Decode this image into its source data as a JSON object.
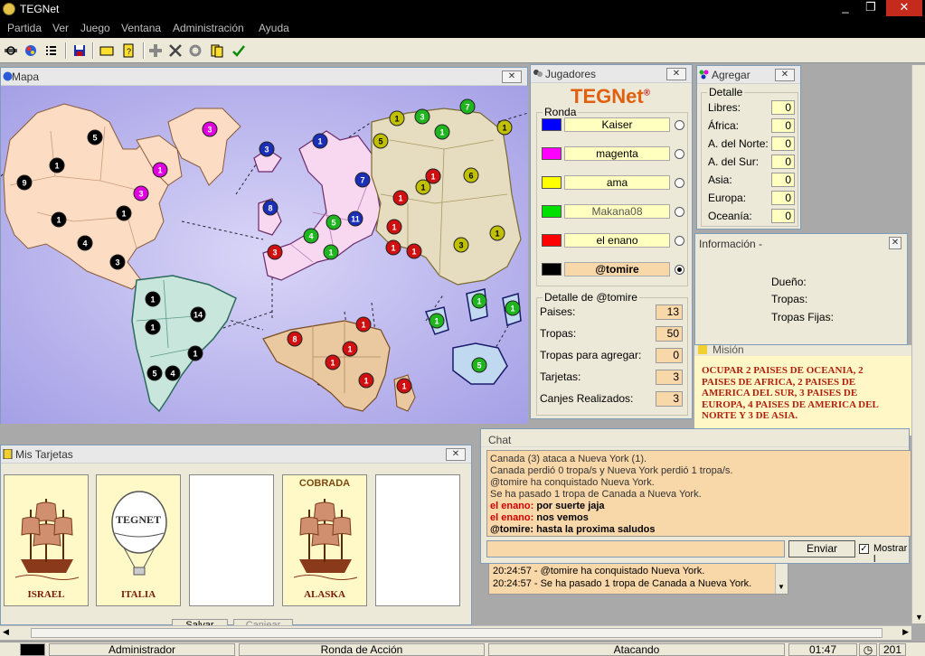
{
  "window": {
    "title": "TEGNet",
    "min": "_",
    "max": "❐",
    "close": "✕"
  },
  "menu": [
    "Partida",
    "Ver",
    "Juego",
    "Ventana",
    "Administración",
    "Ayuda"
  ],
  "toolbar": {
    "icons": [
      "connect-icon",
      "globe-icon",
      "list-icon",
      "save-icon",
      "card-icon",
      "cards-icon",
      "add-icon",
      "attack-icon",
      "settings-icon",
      "regroup-icon",
      "done-icon"
    ]
  },
  "mapa": {
    "title": "Mapa",
    "close": "✕",
    "armies": [
      {
        "n": "5",
        "c": "#000"
      },
      {
        "n": "3",
        "c": "#e000e0"
      },
      {
        "n": "1",
        "c": "#000"
      },
      {
        "n": "1",
        "c": "#e000e0"
      },
      {
        "n": "9",
        "c": "#000"
      },
      {
        "n": "3",
        "c": "#e000e0"
      },
      {
        "n": "1",
        "c": "#000"
      },
      {
        "n": "1",
        "c": "#000"
      },
      {
        "n": "4",
        "c": "#000"
      },
      {
        "n": "3",
        "c": "#000"
      },
      {
        "n": "3",
        "c": "#1a2eb8"
      },
      {
        "n": "1",
        "c": "#1a2eb8"
      },
      {
        "n": "8",
        "c": "#1a2eb8"
      },
      {
        "n": "7",
        "c": "#1a2eb8"
      },
      {
        "n": "5",
        "c": "#1fb51f"
      },
      {
        "n": "11",
        "c": "#1a2eb8"
      },
      {
        "n": "4",
        "c": "#1fb51f"
      },
      {
        "n": "3",
        "c": "#d01010"
      },
      {
        "n": "1",
        "c": "#1fb51f"
      },
      {
        "n": "1",
        "c": "#d01010"
      },
      {
        "n": "1",
        "c": "#d01010"
      },
      {
        "n": "1",
        "c": "#d01010"
      },
      {
        "n": "1",
        "c": "#d01010"
      },
      {
        "n": "1",
        "c": "#d01010"
      },
      {
        "n": "1",
        "c": "#c0c000"
      },
      {
        "n": "3",
        "c": "#1fb51f"
      },
      {
        "n": "7",
        "c": "#1fb51f"
      },
      {
        "n": "5",
        "c": "#c0c000"
      },
      {
        "n": "1",
        "c": "#1fb51f"
      },
      {
        "n": "1",
        "c": "#c0c000"
      },
      {
        "n": "1",
        "c": "#d01010"
      },
      {
        "n": "6",
        "c": "#c0c000"
      },
      {
        "n": "1",
        "c": "#c0c000"
      },
      {
        "n": "3",
        "c": "#c0c000"
      },
      {
        "n": "1",
        "c": "#c0c000"
      },
      {
        "n": "1",
        "c": "#000"
      },
      {
        "n": "14",
        "c": "#000"
      },
      {
        "n": "1",
        "c": "#000"
      },
      {
        "n": "1",
        "c": "#000"
      },
      {
        "n": "5",
        "c": "#000"
      },
      {
        "n": "4",
        "c": "#000"
      },
      {
        "n": "8",
        "c": "#d01010"
      },
      {
        "n": "1",
        "c": "#d01010"
      },
      {
        "n": "1",
        "c": "#d01010"
      },
      {
        "n": "1",
        "c": "#d01010"
      },
      {
        "n": "1",
        "c": "#d01010"
      },
      {
        "n": "1",
        "c": "#d01010"
      },
      {
        "n": "1",
        "c": "#1fb51f"
      },
      {
        "n": "1",
        "c": "#1fb51f"
      },
      {
        "n": "1",
        "c": "#1fb51f"
      },
      {
        "n": "5",
        "c": "#1fb51f"
      }
    ]
  },
  "jugadores": {
    "title": "Jugadores",
    "close": "✕",
    "logo": "TEGNet",
    "logo_mark": "®",
    "ronda_label": "Ronda",
    "players": [
      {
        "name": "Kaiser",
        "color": "#0000ff",
        "bg": "#ffffc0",
        "selected": false,
        "bold": false
      },
      {
        "name": "magenta",
        "color": "#ff00ff",
        "bg": "#ffffc0",
        "selected": false,
        "bold": false
      },
      {
        "name": "ama",
        "color": "#ffff00",
        "bg": "#ffffc0",
        "selected": false,
        "bold": false
      },
      {
        "name": "Makana08",
        "color": "#00e000",
        "bg": "#ffffc0",
        "selected": false,
        "bold": false
      },
      {
        "name": "el enano",
        "color": "#ff0000",
        "bg": "#ffffc0",
        "selected": false,
        "bold": false
      },
      {
        "name": "@tomire",
        "color": "#000000",
        "bg": "#f8d7a9",
        "selected": true,
        "bold": true
      }
    ],
    "detalle_label": "Detalle de @tomire",
    "detalle": [
      {
        "label": "Paises:",
        "value": "13"
      },
      {
        "label": "Tropas:",
        "value": "50"
      },
      {
        "label": "Tropas para agregar:",
        "value": "0"
      },
      {
        "label": "Tarjetas:",
        "value": "3"
      },
      {
        "label": "Canjes Realizados:",
        "value": "3"
      }
    ]
  },
  "agregar": {
    "title": "Agregar",
    "close": "✕",
    "detalle_label": "Detalle",
    "rows": [
      {
        "label": "Libres:",
        "value": "0"
      },
      {
        "label": "África:",
        "value": "0"
      },
      {
        "label": "A. del Norte:",
        "value": "0"
      },
      {
        "label": "A. del Sur:",
        "value": "0"
      },
      {
        "label": "Asia:",
        "value": "0"
      },
      {
        "label": "Europa:",
        "value": "0"
      },
      {
        "label": "Oceanía:",
        "value": "0"
      }
    ]
  },
  "informacion": {
    "title": "Información -",
    "close": "✕",
    "rows": [
      "Dueño:",
      "Tropas:",
      "Tropas Fijas:"
    ]
  },
  "mision": {
    "title": "Misión",
    "text": "OCUPAR 2 PAISES DE OCEANIA, 2 PAISES DE AFRICA, 2 PAISES DE AMERICA DEL SUR, 3 PAISES DE EUROPA, 4 PAISES DE AMERICA DEL NORTE Y 3 DE ASIA."
  },
  "tarjetas": {
    "title": "Mis Tarjetas",
    "close": "✕",
    "cards": [
      {
        "name": "ISRAEL",
        "type": "ship",
        "cobrada": ""
      },
      {
        "name": "ITALIA",
        "type": "balloon",
        "cobrada": ""
      },
      {
        "name": "",
        "type": "empty",
        "cobrada": ""
      },
      {
        "name": "ALASKA",
        "type": "ship",
        "cobrada": "COBRADA"
      },
      {
        "name": "",
        "type": "empty",
        "cobrada": ""
      }
    ],
    "balloon_text": "TEGNET",
    "btn1": "Salvar",
    "btn2": "Canjear"
  },
  "chat": {
    "title": "Chat",
    "lines": [
      {
        "who": "",
        "text": "Canada (3) ataca a Nueva York (1).",
        "kind": "sys"
      },
      {
        "who": "",
        "text": "Canada perdió 0 tropa/s y Nueva York perdió 1 tropa/s.",
        "kind": "sys"
      },
      {
        "who": "",
        "text": "@tomire ha conquistado Nueva York.",
        "kind": "sys"
      },
      {
        "who": "",
        "text": "Se ha pasado 1 tropa de Canada a Nueva York.",
        "kind": "sys"
      },
      {
        "who": "el enano",
        "text": "por suerte jaja",
        "kind": "red"
      },
      {
        "who": "el enano",
        "text": "nos vemos",
        "kind": "red"
      },
      {
        "who": "@tomire",
        "text": "hasta la proxima saludos",
        "kind": "black"
      }
    ],
    "send": "Enviar",
    "show": "Mostrar l"
  },
  "log": {
    "lines": [
      "20:24:57 - @tomire ha conquistado Nueva York.",
      "20:24:57 - Se ha pasado 1 tropa de Canada a Nueva York."
    ]
  },
  "status": {
    "user": "Administrador",
    "round": "Ronda de Acción",
    "state": "Atacando",
    "time": "01:47",
    "extra": "201"
  }
}
